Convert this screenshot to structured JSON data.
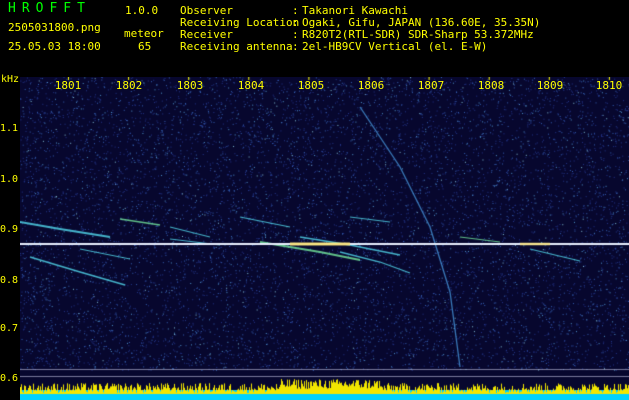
{
  "header": {
    "app_title": "HROFFT",
    "version": "1.0.0",
    "filename": "2505031800.png",
    "datetime": "25.05.03 18:00",
    "meteor_label": "meteor",
    "meteor_count": "65"
  },
  "info": [
    {
      "key": "Observer",
      "value": "Takanori Kawachi"
    },
    {
      "key": "Receiving Location",
      "value": "Ogaki, Gifu, JAPAN (136.60E, 35.35N)"
    },
    {
      "key": "Receiver",
      "value": "R820T2(RTL-SDR) SDR-Sharp 53.372MHz"
    },
    {
      "key": "Receiving antenna",
      "value": "2el-HB9CV Vertical (el. E-W)"
    }
  ],
  "separator": ":",
  "axis": {
    "y_unit": "kHz",
    "y_ticks": [
      "1.1",
      "1.0",
      "0.9",
      "0.8",
      "0.7",
      "0.6"
    ],
    "x_ticks": [
      "1801",
      "1802",
      "1803",
      "1804",
      "1805",
      "1806",
      "1807",
      "1808",
      "1809",
      "1810"
    ]
  },
  "colors": {
    "background": "#07072e",
    "text": "#ffff00",
    "title": "#00ff00",
    "carrier": "#e8f0ff",
    "level_bar": "#f2e600",
    "level_base": "#00d2ff"
  }
}
